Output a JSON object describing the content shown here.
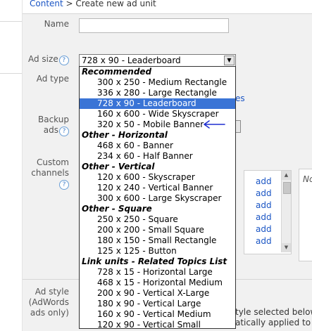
{
  "breadcrumb": {
    "link": "Content",
    "sep": " > ",
    "current": "Create new ad unit"
  },
  "form": {
    "name_label": "Name",
    "ad_size_label": "Ad size",
    "ad_size_value": "728 x 90 - Leaderboard",
    "ad_type_label": "Ad type",
    "backup_label_1": "Backup",
    "backup_label_2": "ads",
    "custom_label_1": "Custom",
    "custom_label_2": "channels",
    "ad_style_label_1": "Ad style",
    "ad_style_label_2": "(AdWords",
    "ad_style_label_3": "ads only)",
    "help_glyph": "?",
    "add_link": "add",
    "panel_fragment": "No",
    "partial_link_fragment": "es",
    "style_note_1": "tyle selected below",
    "style_note_2": "atically applied to th"
  },
  "dropdown": {
    "selected": "728 x 90 - Leaderboard",
    "groups": [
      {
        "label": "Recommended",
        "items": [
          "300 x 250 - Medium Rectangle",
          "336 x 280 - Large Rectangle",
          "728 x 90 - Leaderboard",
          "160 x 600 - Wide Skyscraper",
          "320 x 50 - Mobile Banner"
        ]
      },
      {
        "label": "Other - Horizontal",
        "items": [
          "468 x 60 - Banner",
          "234 x 60 - Half Banner"
        ]
      },
      {
        "label": "Other - Vertical",
        "items": [
          "120 x 600 - Skyscraper",
          "120 x 240 - Vertical Banner",
          "300 x 600 - Large Skyscraper"
        ]
      },
      {
        "label": "Other - Square",
        "items": [
          "250 x 250 - Square",
          "200 x 200 - Small Square",
          "180 x 150 - Small Rectangle",
          "125 x 125 - Button"
        ]
      },
      {
        "label": "Link units - Related Topics List",
        "items": [
          "728 x 15 - Horizontal Large",
          "468 x 15 - Horizontal Medium",
          "200 x 90 - Vertical X-Large",
          "180 x 90 - Vertical Large",
          "160 x 90 - Vertical Medium",
          "120 x 90 - Vertical Small"
        ]
      }
    ]
  },
  "annotation": {
    "arrow_color": "#1f2fd0"
  },
  "colors": {
    "link": "#1a55c4",
    "selected_bg": "#3a74d6",
    "panel_bg": "#f1f1f1"
  },
  "icons": {
    "dropdown_arrow": "chevron-down-icon",
    "help": "help-icon",
    "annotation": "arrow-left-icon"
  }
}
